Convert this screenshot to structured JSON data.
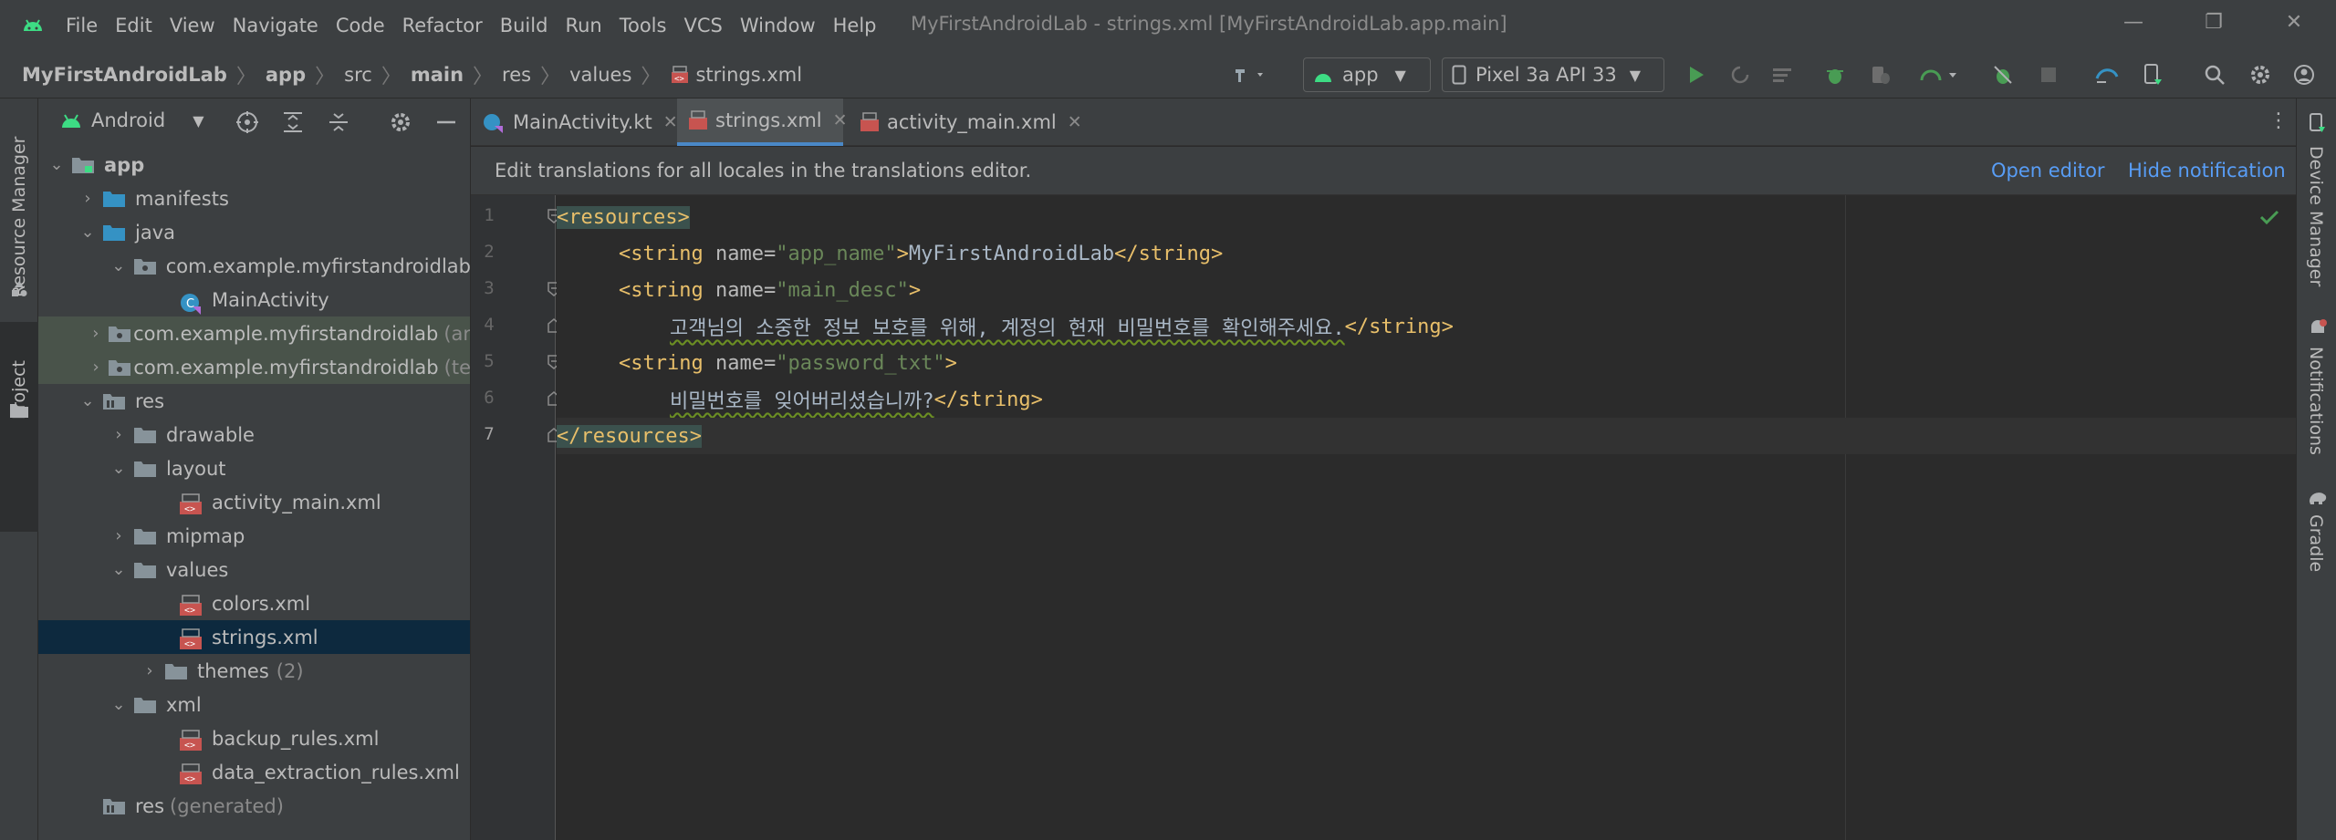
{
  "menu": [
    "File",
    "Edit",
    "View",
    "Navigate",
    "Code",
    "Refactor",
    "Build",
    "Run",
    "Tools",
    "VCS",
    "Window",
    "Help"
  ],
  "window_title": "MyFirstAndroidLab - strings.xml [MyFirstAndroidLab.app.main]",
  "breadcrumb": [
    "MyFirstAndroidLab",
    "app",
    "src",
    "main",
    "res",
    "values",
    "strings.xml"
  ],
  "toolbar": {
    "run_config": "app",
    "device": "Pixel 3a API 33"
  },
  "left_stripe": {
    "resource_manager": "Resource Manager",
    "project": "Project"
  },
  "right_stripe": {
    "device_manager": "Device Manager",
    "notifications": "Notifications",
    "gradle": "Gradle"
  },
  "project_panel": {
    "view_mode": "Android",
    "tree": [
      {
        "label": "app",
        "suffix": "",
        "bold": true
      },
      {
        "label": "manifests",
        "suffix": ""
      },
      {
        "label": "java",
        "suffix": ""
      },
      {
        "label": "com.example.myfirstandroidlab",
        "suffix": ""
      },
      {
        "label": "MainActivity",
        "suffix": ""
      },
      {
        "label": "com.example.myfirstandroidlab",
        "suffix": "(ar"
      },
      {
        "label": "com.example.myfirstandroidlab",
        "suffix": "(te"
      },
      {
        "label": "res",
        "suffix": ""
      },
      {
        "label": "drawable",
        "suffix": ""
      },
      {
        "label": "layout",
        "suffix": ""
      },
      {
        "label": "activity_main.xml",
        "suffix": ""
      },
      {
        "label": "mipmap",
        "suffix": ""
      },
      {
        "label": "values",
        "suffix": ""
      },
      {
        "label": "colors.xml",
        "suffix": ""
      },
      {
        "label": "strings.xml",
        "suffix": ""
      },
      {
        "label": "themes",
        "suffix": "(2)"
      },
      {
        "label": "xml",
        "suffix": ""
      },
      {
        "label": "backup_rules.xml",
        "suffix": ""
      },
      {
        "label": "data_extraction_rules.xml",
        "suffix": ""
      },
      {
        "label": "res",
        "suffix": "(generated)"
      }
    ]
  },
  "tabs": [
    {
      "label": "MainActivity.kt"
    },
    {
      "label": "strings.xml"
    },
    {
      "label": "activity_main.xml"
    }
  ],
  "notification": {
    "message": "Edit translations for all locales in the translations editor.",
    "open_editor": "Open editor",
    "hide": "Hide notification"
  },
  "code": {
    "line_numbers": [
      "1",
      "2",
      "3",
      "4",
      "5",
      "6",
      "7"
    ],
    "l1_tag": "<resources>",
    "l2_open": "<string ",
    "l2_attr": "name=",
    "l2_val": "\"app_name\"",
    "l2_close": ">",
    "l2_text": "MyFirstAndroidLab",
    "l2_end": "</string>",
    "l3_open": "<string ",
    "l3_attr": "name=",
    "l3_val": "\"main_desc\"",
    "l3_close": ">",
    "l4_text": "고객님의 소중한 정보 보호를 위해, 계정의 현재 비밀번호를 확인해주세요.",
    "l4_end": "</string>",
    "l5_open": "<string ",
    "l5_attr": "name=",
    "l5_val": "\"password_txt\"",
    "l5_close": ">",
    "l6_text": "비밀번호를 잊어버리셨습니까?",
    "l6_end": "</string>",
    "l7_tag": "</resources>"
  }
}
